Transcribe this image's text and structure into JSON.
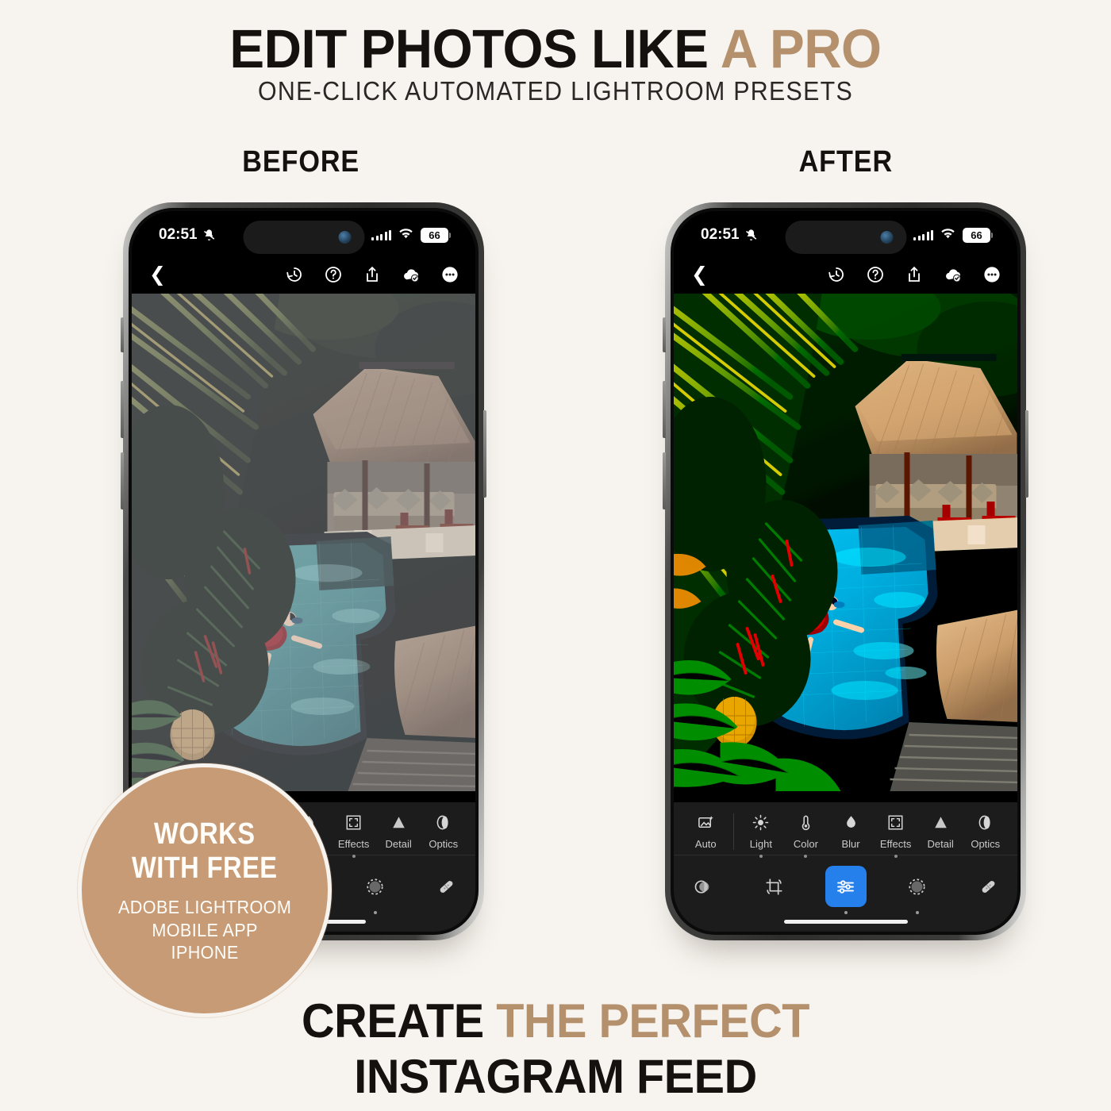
{
  "theme": {
    "background": "#F7F4EF",
    "accent_tan": "#B5906C",
    "badge_bg": "#C79B76",
    "ink": "#14110F",
    "lightroom_blue": "#2680EB"
  },
  "headline": {
    "part1": "EDIT PHOTOS LIKE ",
    "part2": "A PRO"
  },
  "subhead": "ONE-CLICK AUTOMATED LIGHTROOM PRESETS",
  "labels": {
    "before": "BEFORE",
    "after": "AFTER"
  },
  "tagline": {
    "line1_part1": "CREATE ",
    "line1_part2": "THE PERFECT",
    "line2": "INSTAGRAM FEED"
  },
  "badge": {
    "line1": "WORKS",
    "line2": "WITH FREE",
    "line3": "ADOBE LIGHTROOM",
    "line4": "MOBILE APP",
    "line5": "IPHONE"
  },
  "phone": {
    "status": {
      "time": "02:51",
      "mute_icon": "bell-slash-icon",
      "signal_icon": "cellular-signal-icon",
      "wifi_icon": "wifi-icon",
      "battery": "66"
    },
    "app_toolbar": {
      "back_icon": "chevron-left-icon",
      "items": [
        {
          "icon": "history-icon",
          "name": "version-history-button"
        },
        {
          "icon": "help-icon",
          "name": "help-button"
        },
        {
          "icon": "share-icon",
          "name": "share-button"
        },
        {
          "icon": "cloud-check-icon",
          "name": "cloud-synced-status"
        },
        {
          "icon": "more-icon",
          "name": "more-options-button"
        }
      ]
    },
    "edit_tools": [
      {
        "label": "Auto",
        "icon": "auto-enhance-icon",
        "has_dot": false
      },
      {
        "label": "Light",
        "icon": "sun-icon",
        "has_dot": true
      },
      {
        "label": "Color",
        "icon": "thermometer-icon",
        "has_dot": true
      },
      {
        "label": "Blur",
        "icon": "droplet-icon",
        "has_dot": false
      },
      {
        "label": "Effects",
        "icon": "frame-icon",
        "has_dot": true
      },
      {
        "label": "Detail",
        "icon": "triangle-icon",
        "has_dot": false
      },
      {
        "label": "Optics",
        "icon": "lens-icon",
        "has_dot": false
      }
    ],
    "mode_tools": [
      {
        "icon": "presets-icon",
        "name": "presets-button",
        "selected": false,
        "has_dot": false
      },
      {
        "icon": "crop-icon",
        "name": "crop-button",
        "selected": false,
        "has_dot": false
      },
      {
        "icon": "edit-sliders-icon",
        "name": "edit-button",
        "selected": true,
        "has_dot": true
      },
      {
        "icon": "masking-icon",
        "name": "masking-button",
        "selected": false,
        "has_dot": true
      },
      {
        "icon": "healing-icon",
        "name": "healing-button",
        "selected": false,
        "has_dot": false
      }
    ],
    "home_indicator": "home-indicator"
  },
  "photo": {
    "description_before": "aerial tropical resort: palms, thatched bale, woman in red swimsuit floating in pool — flat muted grade",
    "description_after": "same scene — vivid saturated preset grade, cyan pool, rich greens"
  }
}
